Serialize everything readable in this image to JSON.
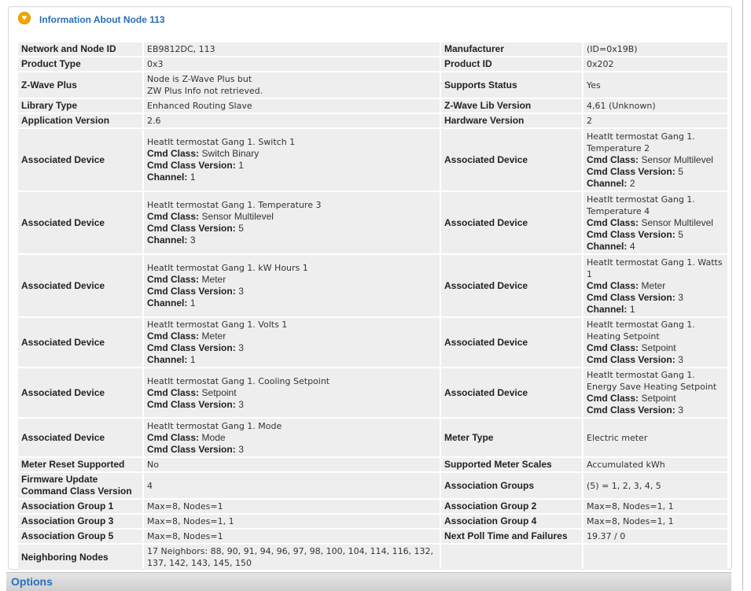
{
  "panel": {
    "title": "Information About Node 113",
    "toggle_icon": "chevron-down-circle-icon",
    "accent_color": "#2a6ebb",
    "icon_color": "#f2a600"
  },
  "rows": [
    {
      "left": {
        "label": "Network and Node ID",
        "value": "EB9812DC, 113"
      },
      "right": {
        "label": "Manufacturer",
        "value": "(ID=0x19B)"
      }
    },
    {
      "left": {
        "label": "Product Type",
        "value": "0x3"
      },
      "right": {
        "label": "Product ID",
        "value": "0x202"
      }
    },
    {
      "left": {
        "label": "Z-Wave Plus",
        "value_lines": [
          "Node is Z-Wave Plus but",
          "ZW Plus Info not retrieved."
        ]
      },
      "right": {
        "label": "Supports Status",
        "value": "Yes"
      }
    },
    {
      "left": {
        "label": "Library Type",
        "value": "Enhanced Routing Slave"
      },
      "right": {
        "label": "Z-Wave Lib Version",
        "value": "4,61 (Unknown)"
      }
    },
    {
      "left": {
        "label": "Application Version",
        "value": "2.6"
      },
      "right": {
        "label": "Hardware Version",
        "value": "2"
      }
    },
    {
      "left": {
        "label": "Associated Device",
        "device": {
          "name": "HeatIt termostat Gang 1. Switch 1",
          "cmd_class": "Switch Binary",
          "cmd_class_version": "1",
          "channel": "1"
        }
      },
      "right": {
        "label": "Associated Device",
        "device": {
          "name": "HeatIt termostat Gang 1. Temperature 2",
          "cmd_class": "Sensor Multilevel",
          "cmd_class_version": "5",
          "channel": "2"
        }
      }
    },
    {
      "left": {
        "label": "Associated Device",
        "device": {
          "name": "HeatIt termostat Gang 1. Temperature 3",
          "cmd_class": "Sensor Multilevel",
          "cmd_class_version": "5",
          "channel": "3"
        }
      },
      "right": {
        "label": "Associated Device",
        "device": {
          "name": "HeatIt termostat Gang 1. Temperature 4",
          "cmd_class": "Sensor Multilevel",
          "cmd_class_version": "5",
          "channel": "4"
        }
      }
    },
    {
      "left": {
        "label": "Associated Device",
        "device": {
          "name": "HeatIt termostat Gang 1. kW Hours 1",
          "cmd_class": "Meter",
          "cmd_class_version": "3",
          "channel": "1"
        }
      },
      "right": {
        "label": "Associated Device",
        "device": {
          "name": "HeatIt termostat Gang 1. Watts 1",
          "cmd_class": "Meter",
          "cmd_class_version": "3",
          "channel": "1"
        }
      }
    },
    {
      "left": {
        "label": "Associated Device",
        "device": {
          "name": "HeatIt termostat Gang 1. Volts 1",
          "cmd_class": "Meter",
          "cmd_class_version": "3",
          "channel": "1"
        }
      },
      "right": {
        "label": "Associated Device",
        "device": {
          "name": "HeatIt termostat Gang 1. Heating Setpoint",
          "cmd_class": "Setpoint",
          "cmd_class_version": "3"
        }
      }
    },
    {
      "left": {
        "label": "Associated Device",
        "device": {
          "name": "HeatIt termostat Gang 1. Cooling Setpoint",
          "cmd_class": "Setpoint",
          "cmd_class_version": "3"
        }
      },
      "right": {
        "label": "Associated Device",
        "device": {
          "name": "HeatIt termostat Gang 1. Energy Save Heating Setpoint",
          "cmd_class": "Setpoint",
          "cmd_class_version": "3"
        }
      }
    },
    {
      "left": {
        "label": "Associated Device",
        "device": {
          "name": "HeatIt termostat Gang 1. Mode",
          "cmd_class": "Mode",
          "cmd_class_version": "3"
        }
      },
      "right": {
        "label": "Meter Type",
        "value": "Electric meter"
      }
    },
    {
      "left": {
        "label": "Meter Reset Supported",
        "value": "No"
      },
      "right": {
        "label": "Supported Meter Scales",
        "value": "Accumulated kWh"
      }
    },
    {
      "left": {
        "label": "Firmware Update Command Class Version",
        "value": "4"
      },
      "right": {
        "label": "Association Groups",
        "value": "(5) = 1, 2, 3, 4, 5"
      }
    },
    {
      "left": {
        "label": "Association Group 1",
        "value": "Max=8, Nodes=1"
      },
      "right": {
        "label": "Association Group 2",
        "value": "Max=8, Nodes=1, 1"
      }
    },
    {
      "left": {
        "label": "Association Group 3",
        "value": "Max=8, Nodes=1, 1"
      },
      "right": {
        "label": "Association Group 4",
        "value": "Max=8, Nodes=1, 1"
      }
    },
    {
      "left": {
        "label": "Association Group 5",
        "value": "Max=8, Nodes=1"
      },
      "right": {
        "label": "Next Poll Time and Failures",
        "value": "19.37 / 0"
      }
    },
    {
      "left": {
        "label": "Neighboring Nodes",
        "value": "17 Neighbors: 88, 90, 91, 94, 96, 97, 98, 100, 104, 114, 116, 132, 137, 142, 143, 145, 150"
      },
      "right": {
        "label": "",
        "value": ""
      }
    }
  ],
  "device_fields": {
    "cmd_class_label": "Cmd Class:",
    "cmd_class_version_label": "Cmd Class Version:",
    "channel_label": "Channel:"
  },
  "options": {
    "label": "Options"
  }
}
